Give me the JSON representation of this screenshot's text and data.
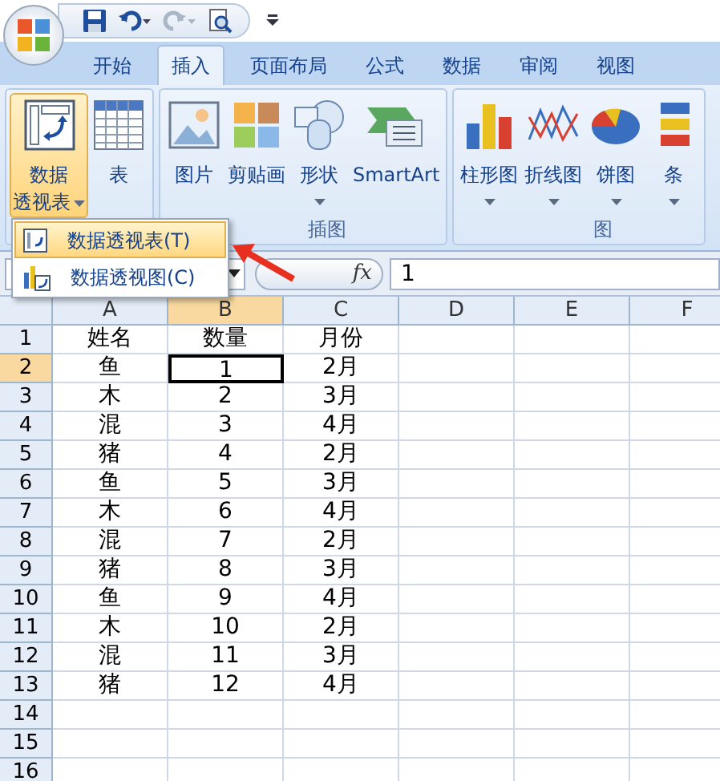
{
  "quick_access": [
    {
      "kind": "save",
      "disabled": false
    },
    {
      "kind": "undo",
      "disabled": false
    },
    {
      "kind": "redo",
      "disabled": true
    },
    {
      "kind": "preview",
      "disabled": false
    }
  ],
  "tabs": [
    {
      "label": "开始",
      "selected": false
    },
    {
      "label": "插入",
      "selected": true
    },
    {
      "label": "页面布局",
      "selected": false
    },
    {
      "label": "公式",
      "selected": false
    },
    {
      "label": "数据",
      "selected": false
    },
    {
      "label": "审阅",
      "selected": false
    },
    {
      "label": "视图",
      "selected": false
    }
  ],
  "ribbon_groups": [
    {
      "buttons": [
        {
          "kind": "pivot",
          "lines": [
            "数据",
            "透视表"
          ],
          "dropdown": true,
          "pressed": true
        },
        {
          "kind": "table",
          "lines": [
            "表"
          ],
          "dropdown": false,
          "pressed": false
        }
      ]
    },
    {
      "label": "插图",
      "buttons": [
        {
          "kind": "picture",
          "lines": [
            "图片"
          ],
          "dropdown": false,
          "pressed": false
        },
        {
          "kind": "clipart",
          "lines": [
            "剪贴画"
          ],
          "dropdown": false,
          "pressed": false
        },
        {
          "kind": "shapes",
          "lines": [
            "形状"
          ],
          "dropdown": true,
          "pressed": false
        },
        {
          "kind": "smartart",
          "lines": [
            "SmartArt"
          ],
          "dropdown": false,
          "pressed": false
        }
      ]
    },
    {
      "label": "图",
      "buttons": [
        {
          "kind": "column",
          "lines": [
            "柱形图"
          ],
          "dropdown": true,
          "pressed": false
        },
        {
          "kind": "line",
          "lines": [
            "折线图"
          ],
          "dropdown": true,
          "pressed": false
        },
        {
          "kind": "pie",
          "lines": [
            "饼图"
          ],
          "dropdown": true,
          "pressed": false
        },
        {
          "kind": "bar",
          "lines": [
            "条"
          ],
          "dropdown": true,
          "pressed": false
        }
      ]
    }
  ],
  "menu": [
    {
      "label": "数据透视表(T)",
      "kind": "pivot",
      "selected": true
    },
    {
      "label": "数据透视图(C)",
      "kind": "pivotchart",
      "selected": false
    }
  ],
  "formula_bar": {
    "function_label": "fx",
    "value": "1"
  },
  "columns": [
    {
      "label": "A",
      "selected": false
    },
    {
      "label": "B",
      "selected": true
    },
    {
      "label": "C",
      "selected": false
    },
    {
      "label": "D",
      "selected": false
    },
    {
      "label": "E",
      "selected": false
    },
    {
      "label": "F",
      "selected": false
    }
  ],
  "rows": [
    {
      "label": "1",
      "selected": false,
      "cells": [
        {
          "text": "姓名",
          "selected": false
        },
        {
          "text": "数量",
          "selected": false
        },
        {
          "text": "月份",
          "selected": false
        }
      ]
    },
    {
      "label": "2",
      "selected": true,
      "cells": [
        {
          "text": "鱼",
          "selected": false
        },
        {
          "text": "1",
          "selected": true
        },
        {
          "text": "2月",
          "selected": false
        }
      ]
    },
    {
      "label": "3",
      "selected": false,
      "cells": [
        {
          "text": "木",
          "selected": false
        },
        {
          "text": "2",
          "selected": false
        },
        {
          "text": "3月",
          "selected": false
        }
      ]
    },
    {
      "label": "4",
      "selected": false,
      "cells": [
        {
          "text": "混",
          "selected": false
        },
        {
          "text": "3",
          "selected": false
        },
        {
          "text": "4月",
          "selected": false
        }
      ]
    },
    {
      "label": "5",
      "selected": false,
      "cells": [
        {
          "text": "猪",
          "selected": false
        },
        {
          "text": "4",
          "selected": false
        },
        {
          "text": "2月",
          "selected": false
        }
      ]
    },
    {
      "label": "6",
      "selected": false,
      "cells": [
        {
          "text": "鱼",
          "selected": false
        },
        {
          "text": "5",
          "selected": false
        },
        {
          "text": "3月",
          "selected": false
        }
      ]
    },
    {
      "label": "7",
      "selected": false,
      "cells": [
        {
          "text": "木",
          "selected": false
        },
        {
          "text": "6",
          "selected": false
        },
        {
          "text": "4月",
          "selected": false
        }
      ]
    },
    {
      "label": "8",
      "selected": false,
      "cells": [
        {
          "text": "混",
          "selected": false
        },
        {
          "text": "7",
          "selected": false
        },
        {
          "text": "2月",
          "selected": false
        }
      ]
    },
    {
      "label": "9",
      "selected": false,
      "cells": [
        {
          "text": "猪",
          "selected": false
        },
        {
          "text": "8",
          "selected": false
        },
        {
          "text": "3月",
          "selected": false
        }
      ]
    },
    {
      "label": "10",
      "selected": false,
      "cells": [
        {
          "text": "鱼",
          "selected": false
        },
        {
          "text": "9",
          "selected": false
        },
        {
          "text": "4月",
          "selected": false
        }
      ]
    },
    {
      "label": "11",
      "selected": false,
      "cells": [
        {
          "text": "木",
          "selected": false
        },
        {
          "text": "10",
          "selected": false
        },
        {
          "text": "2月",
          "selected": false
        }
      ]
    },
    {
      "label": "12",
      "selected": false,
      "cells": [
        {
          "text": "混",
          "selected": false
        },
        {
          "text": "11",
          "selected": false
        },
        {
          "text": "3月",
          "selected": false
        }
      ]
    },
    {
      "label": "13",
      "selected": false,
      "cells": [
        {
          "text": "猪",
          "selected": false
        },
        {
          "text": "12",
          "selected": false
        },
        {
          "text": "4月",
          "selected": false
        }
      ]
    },
    {
      "label": "14",
      "selected": false
    },
    {
      "label": "15",
      "selected": false
    },
    {
      "label": "16",
      "selected": false
    }
  ]
}
